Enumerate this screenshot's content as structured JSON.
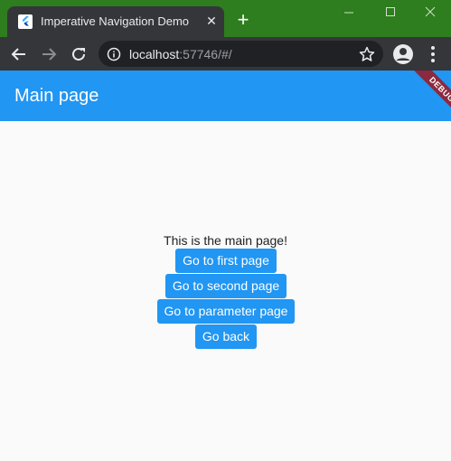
{
  "browser": {
    "tab": {
      "title": "Imperative Navigation Demo",
      "close_glyph": "✕",
      "favicon": "flutter-logo-icon"
    },
    "new_tab_glyph": "+",
    "window_controls": [
      "minimize-icon",
      "maximize-icon",
      "close-icon"
    ],
    "address_bar": {
      "host": "localhost",
      "rest": ":57746/#/",
      "icon": "info-icon"
    },
    "colors": {
      "titlebar": "#2e7d1e",
      "toolbar": "#35363a",
      "omnibox": "#202124"
    }
  },
  "app": {
    "title": "Main page",
    "debug_banner": "DEBUG",
    "appbar_color": "#2196f3",
    "main_text": "This is the main page!",
    "buttons": [
      "Go to first page",
      "Go to second page",
      "Go to parameter page",
      "Go back"
    ]
  }
}
